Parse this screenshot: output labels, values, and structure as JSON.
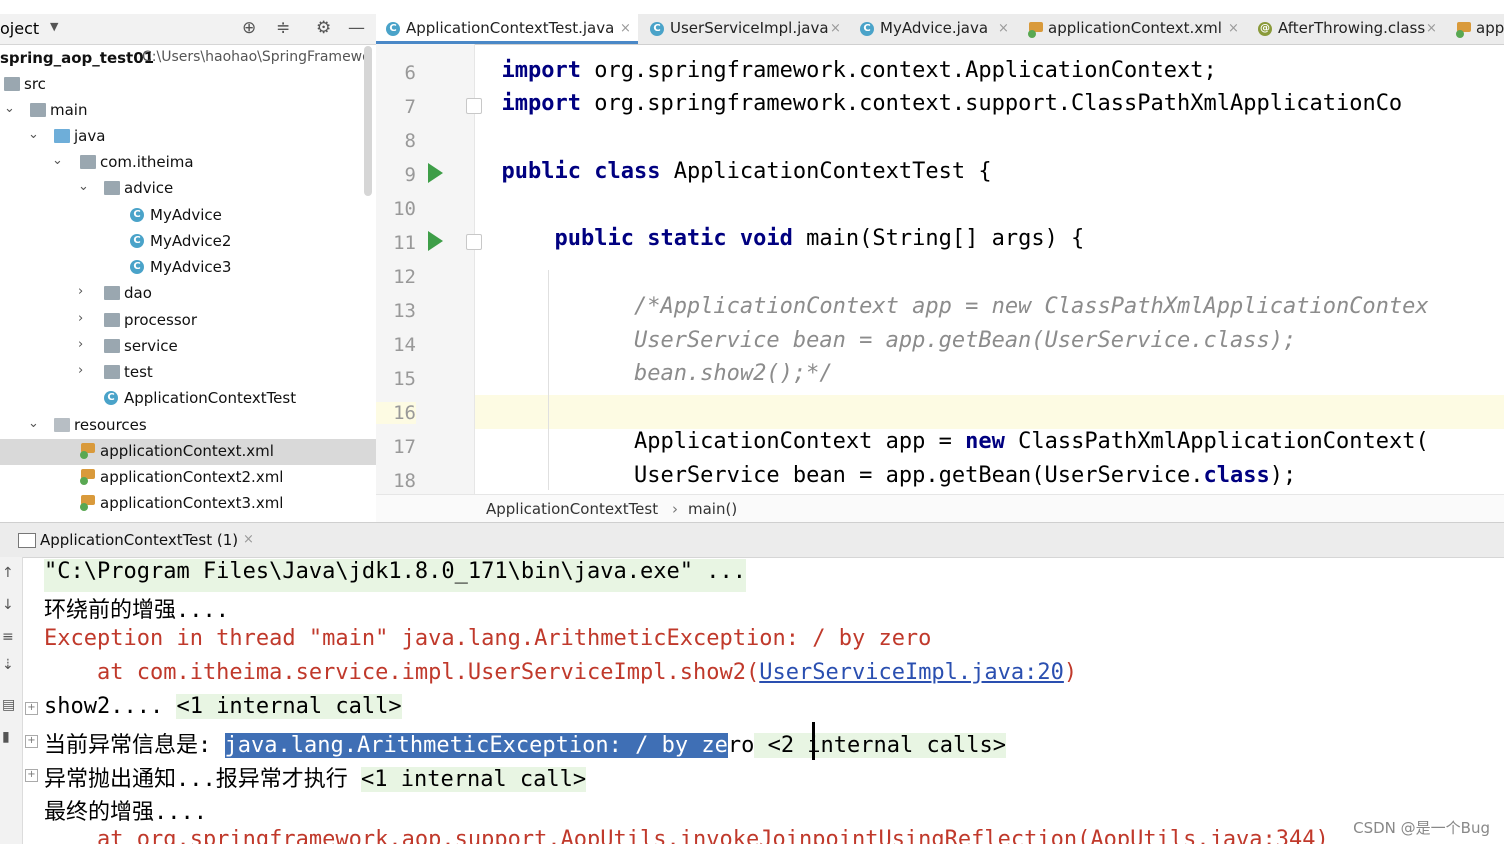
{
  "project": {
    "title": "oject",
    "root_name": "spring_aop_test01",
    "root_path": "C:\\Users\\haohao\\SpringFramewo",
    "items": [
      {
        "label": "src"
      },
      {
        "label": "main"
      },
      {
        "label": "java"
      },
      {
        "label": "com.itheima"
      },
      {
        "label": "advice"
      },
      {
        "label": "MyAdvice"
      },
      {
        "label": "MyAdvice2"
      },
      {
        "label": "MyAdvice3"
      },
      {
        "label": "dao"
      },
      {
        "label": "processor"
      },
      {
        "label": "service"
      },
      {
        "label": "test"
      },
      {
        "label": "ApplicationContextTest"
      },
      {
        "label": "resources"
      },
      {
        "label": "applicationContext.xml"
      },
      {
        "label": "applicationContext2.xml"
      },
      {
        "label": "applicationContext3.xml"
      }
    ]
  },
  "tabs": [
    {
      "label": "ApplicationContextTest.java",
      "close": "×"
    },
    {
      "label": "UserServiceImpl.java",
      "close": "×"
    },
    {
      "label": "MyAdvice.java",
      "close": "×"
    },
    {
      "label": "applicationContext.xml",
      "close": "×"
    },
    {
      "label": "AfterThrowing.class",
      "close": "×"
    },
    {
      "label": "app",
      "close": ""
    }
  ],
  "editor": {
    "line_numbers": [
      "6",
      "7",
      "8",
      "9",
      "10",
      "11",
      "12",
      "13",
      "14",
      "15",
      "16",
      "17",
      "18"
    ],
    "lines": {
      "l6_kw": "import",
      "l6_rest": " org.springframework.context.ApplicationContext;",
      "l7_kw": "import",
      "l7_rest": " org.springframework.context.support.ClassPathXmlApplicationCo",
      "l9_kw": "public class",
      "l9_rest": " ApplicationContextTest {",
      "l11_kw": "public static void",
      "l11_rest": " main(String[] args) {",
      "l13": "/*ApplicationContext app = new ClassPathXmlApplicationContex",
      "l14": "UserService bean = app.getBean(UserService.class);",
      "l15": "bean.show2();*/",
      "l17_a": "ApplicationContext app = ",
      "l17_kw": "new",
      "l17_b": " ClassPathXmlApplicationContext(",
      "l18_a": "UserService bean = app.getBean(UserService.",
      "l18_kw": "class",
      "l18_b": ");"
    },
    "breadcrumb_class": "ApplicationContextTest",
    "breadcrumb_sep": "›",
    "breadcrumb_method": "main()"
  },
  "run": {
    "tab_label": "ApplicationContextTest (1)",
    "tab_close": "×",
    "lines": {
      "o1": "\"C:\\Program Files\\Java\\jdk1.8.0_171\\bin\\java.exe\" ...",
      "o2": "环绕前的增强....",
      "o3": "Exception in thread \"main\" java.lang.ArithmeticException: / by zero",
      "o4_a": "    at com.itheima.service.impl.UserServiceImpl.show2(",
      "o4_link": "UserServiceImpl.java:20",
      "o4_b": ")",
      "o5_a": "show2.... ",
      "o5_hl": "<1 internal call>",
      "o6_a": "当前异常信息是: ",
      "o6_sel": "java.lang.ArithmeticException: / by ze",
      "o6_b": "ro",
      "o6_hl": " <2 internal calls>",
      "o7_a": "异常抛出通知...报异常才执行 ",
      "o7_hl": "<1 internal call>",
      "o8": "最终的增强....",
      "o9": "    at org.springframework.aop.support.AopUtils.invokeJoinpointUsingReflection(AopUtils.java:344)"
    }
  },
  "watermark": "CSDN @是一个Bug"
}
